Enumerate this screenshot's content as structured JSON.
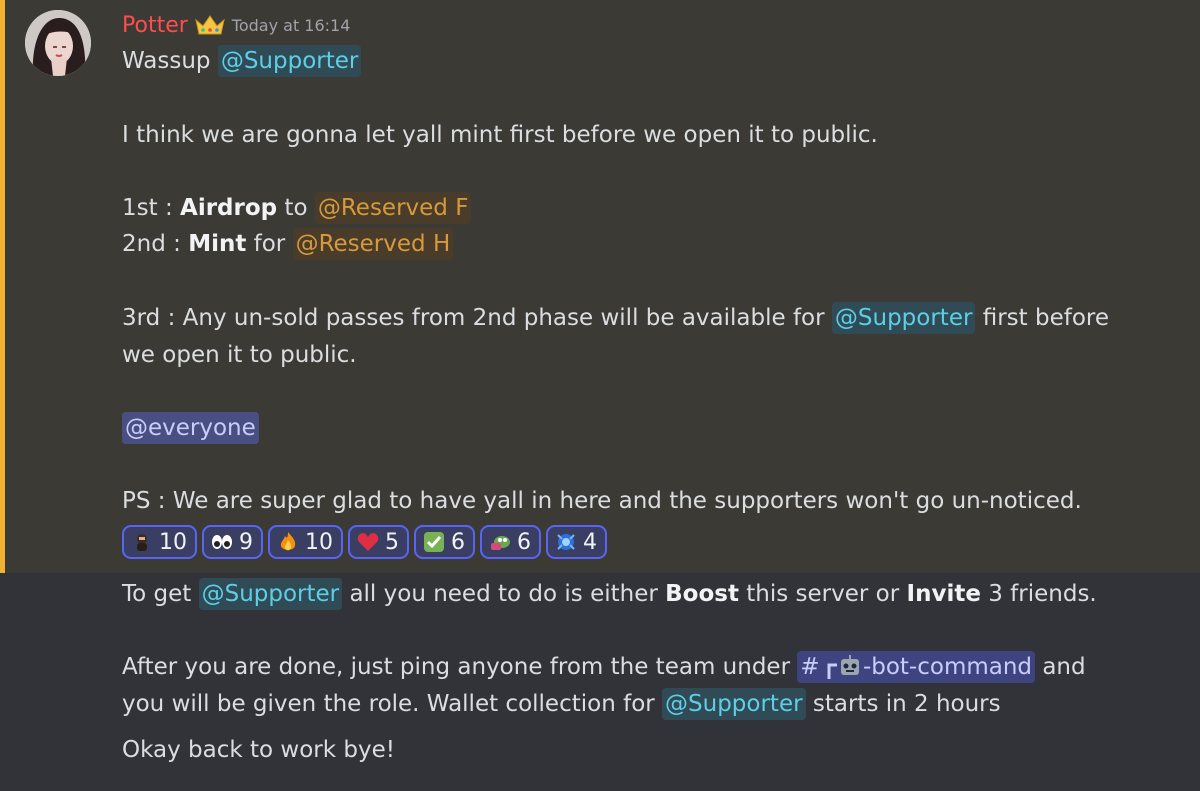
{
  "message": {
    "author": "Potter",
    "timestamp": "Today at 16:14",
    "line1": {
      "text": "Wassup ",
      "mention": "@Supporter"
    },
    "line2": "I think we are gonna let yall mint first before we open it to public.",
    "line3": {
      "prefix": "1st : ",
      "bold": "Airdrop",
      "mid": " to ",
      "mention": "@Reserved F"
    },
    "line4": {
      "prefix": "2nd : ",
      "bold": "Mint",
      "mid": " for ",
      "mention": "@Reserved H"
    },
    "line5": {
      "text": "3rd : Any un-sold passes from 2nd phase will be available for ",
      "mention": "@Supporter",
      "suffix": " first before"
    },
    "line6": "we open it to public.",
    "everyone": "@everyone",
    "ps": "PS : We are super glad to have yall in here and the supporters won't go un-noticed.",
    "reactions": [
      {
        "emoji": "custom-avatar-emoji",
        "count": "10"
      },
      {
        "emoji": "eyes-emoji",
        "count": "9"
      },
      {
        "emoji": "fire-emoji",
        "count": "10"
      },
      {
        "emoji": "heart-emoji",
        "count": "5"
      },
      {
        "emoji": "check-emoji",
        "count": "6"
      },
      {
        "emoji": "custom-pepe-emoji",
        "count": "6"
      },
      {
        "emoji": "custom-blue-emoji",
        "count": "4"
      }
    ]
  },
  "followup": {
    "line1": {
      "prefix": "To get ",
      "mention": "@Supporter",
      "mid1": " all you need to do is either ",
      "bold1": "Boost",
      "mid2": " this server or ",
      "bold2": "Invite",
      "suffix": " 3 friends."
    },
    "line2": {
      "prefix": "After you are done, just ping anyone from the team under ",
      "channel_hash": "#",
      "channel_name": "-bot-command",
      "suffix": " and"
    },
    "line3": {
      "prefix": "you will be given the role. Wallet collection for ",
      "mention": "@Supporter",
      "suffix": " starts in 2 hours"
    },
    "line4": "Okay back to work bye!"
  },
  "colors": {
    "highlight_bg": "#3c3a35",
    "accent": "#f0b232",
    "username": "#ff4d4d",
    "supporter_mention": "#5ccfe6",
    "reserved_mention": "#d69a3b",
    "everyone_mention": "#c9cdfb"
  }
}
